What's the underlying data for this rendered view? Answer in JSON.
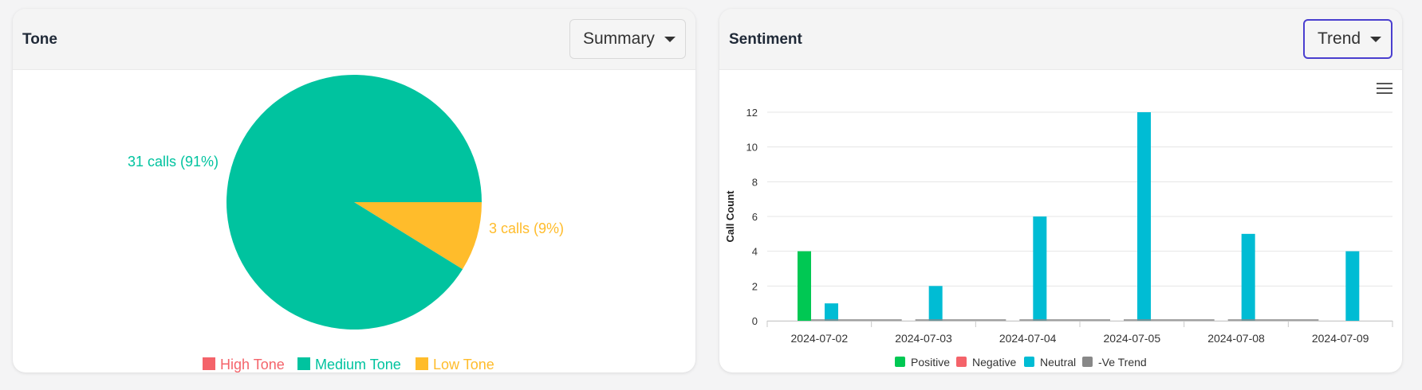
{
  "tone": {
    "title": "Tone",
    "dropdown_label": "Summary",
    "chart_data": {
      "type": "pie",
      "slices": [
        {
          "name": "High Tone",
          "value": 0,
          "color": "#f4636a"
        },
        {
          "name": "Medium Tone",
          "value": 31,
          "color": "#00c39f",
          "label": "31 calls (91%)"
        },
        {
          "name": "Low Tone",
          "value": 3,
          "color": "#ffbc2b",
          "label": "3 calls (9%)"
        }
      ],
      "legend": [
        "High Tone",
        "Medium Tone",
        "Low Tone"
      ],
      "legend_placement": "bottom"
    }
  },
  "sentiment": {
    "title": "Sentiment",
    "dropdown_label": "Trend",
    "menu_icon": "hamburger-menu-icon",
    "chart_data": {
      "type": "bar",
      "categories": [
        "2024-07-02",
        "2024-07-03",
        "2024-07-04",
        "2024-07-05",
        "2024-07-08",
        "2024-07-09"
      ],
      "series": [
        {
          "name": "Positive",
          "color": "#00c853",
          "values": [
            4,
            0,
            0,
            0,
            0,
            0
          ]
        },
        {
          "name": "Negative",
          "color": "#f4636a",
          "values": [
            0,
            0,
            0,
            0,
            0,
            0
          ]
        },
        {
          "name": "Neutral",
          "color": "#00bcd4",
          "values": [
            1,
            2,
            6,
            12,
            5,
            4
          ]
        },
        {
          "name": "-Ve Trend",
          "color": "#888888",
          "values": [
            0,
            0,
            0,
            0,
            0,
            0
          ]
        }
      ],
      "ylabel": "Call Count",
      "yticks": [
        "0",
        "2",
        "4",
        "6",
        "8",
        "10",
        "12"
      ],
      "ylim": [
        0,
        12
      ],
      "grid": true,
      "legend_placement": "bottom"
    }
  }
}
